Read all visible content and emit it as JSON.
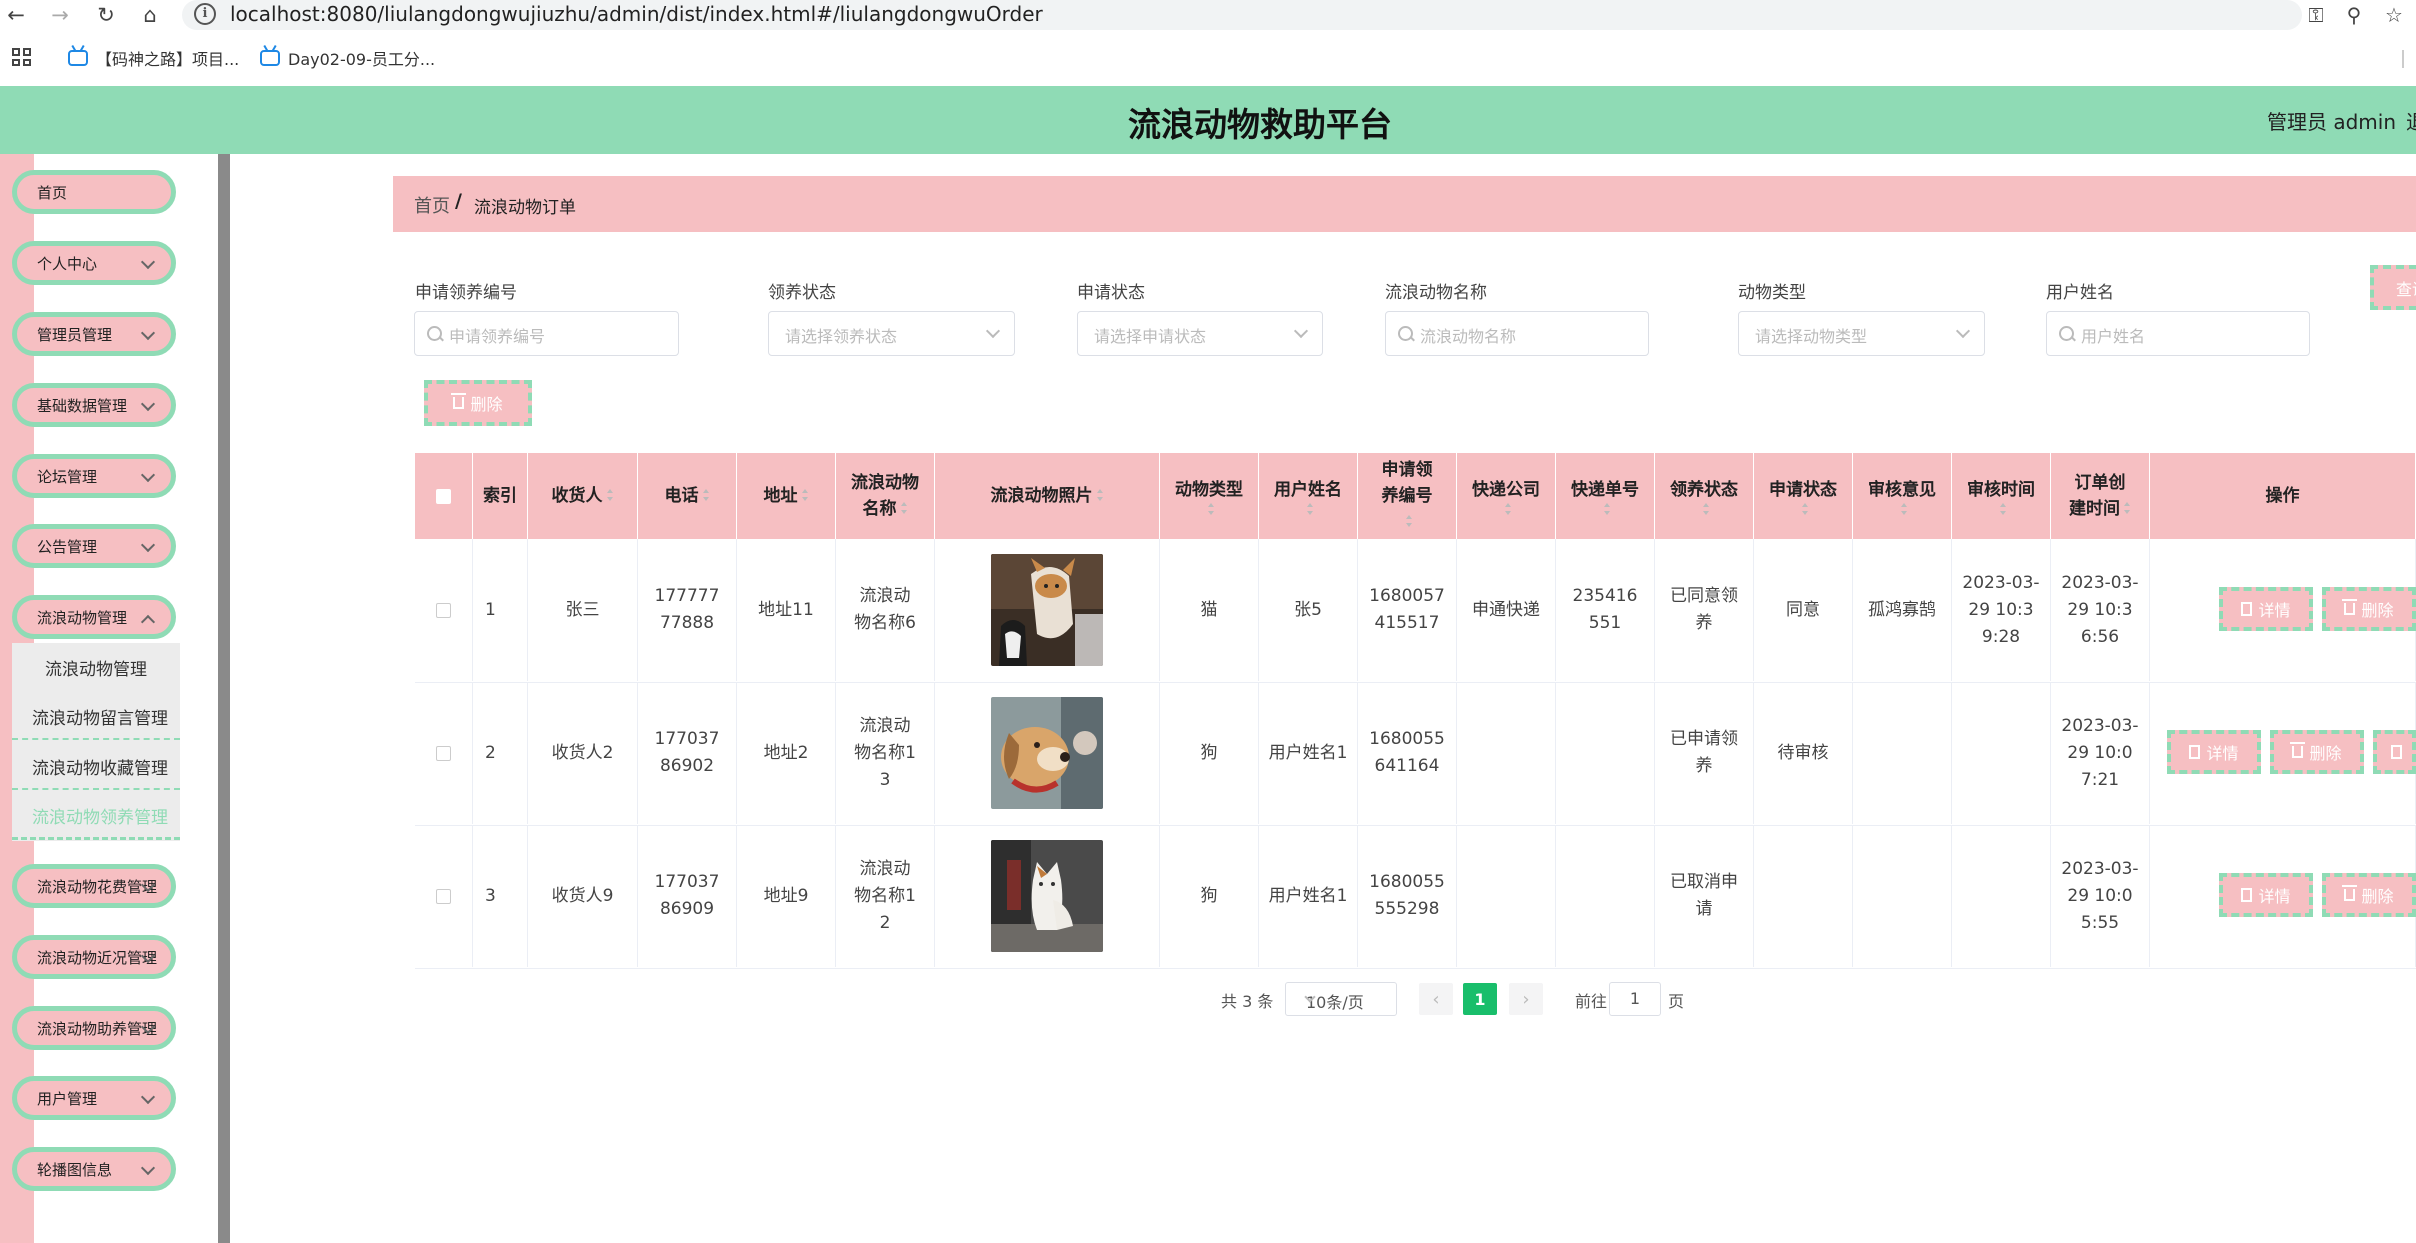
{
  "browser": {
    "url": "localhost:8080/liulangdongwujiuzhu/admin/dist/index.html#/liulangdongwuOrder",
    "bookmarks": [
      "【码神之路】项目...",
      "Day02-09-员工分..."
    ]
  },
  "header": {
    "title": "流浪动物救助平台",
    "admin": "管理员 admin",
    "exit": "退"
  },
  "sidebar": {
    "items": [
      {
        "label": "首页"
      },
      {
        "label": "个人中心"
      },
      {
        "label": "管理员管理"
      },
      {
        "label": "基础数据管理"
      },
      {
        "label": "论坛管理"
      },
      {
        "label": "公告管理"
      },
      {
        "label": "流浪动物管理"
      },
      {
        "label": "流浪动物花费管理"
      },
      {
        "label": "流浪动物近况管理"
      },
      {
        "label": "流浪动物助养管理"
      },
      {
        "label": "用户管理"
      },
      {
        "label": "轮播图信息"
      }
    ],
    "submenu": [
      {
        "label": "流浪动物管理"
      },
      {
        "label": "流浪动物留言管理"
      },
      {
        "label": "流浪动物收藏管理"
      },
      {
        "label": "流浪动物领养管理"
      }
    ]
  },
  "breadcrumb": {
    "home": "首页",
    "separator": "/",
    "current": "流浪动物订单"
  },
  "filters": [
    {
      "label": "申请领养编号",
      "placeholder": "申请领养编号"
    },
    {
      "label": "领养状态",
      "placeholder": "请选择领养状态"
    },
    {
      "label": "申请状态",
      "placeholder": "请选择申请状态"
    },
    {
      "label": "流浪动物名称",
      "placeholder": "流浪动物名称"
    },
    {
      "label": "动物类型",
      "placeholder": "请选择动物类型"
    },
    {
      "label": "用户姓名",
      "placeholder": "用户姓名"
    }
  ],
  "buttons": {
    "query": "查询",
    "delete": "删除",
    "detail": "详情",
    "remove": "删除"
  },
  "table": {
    "headers": [
      "索引",
      "收货人",
      "电话",
      "地址",
      "流浪动物名称",
      "流浪动物照片",
      "动物类型",
      "用户姓名",
      "申请领养编号",
      "快递公司",
      "快递单号",
      "领养状态",
      "申请状态",
      "审核意见",
      "审核时间",
      "订单创建时间",
      "操作"
    ],
    "rows": [
      {
        "index": "1",
        "consignee": "张三",
        "phone": "17777777888",
        "address": "地址11",
        "pet_name": "流浪动物名称6",
        "photo": "cat-and-dog-photo",
        "type": "猫",
        "user": "张5",
        "apply_no": "1680057415517",
        "courier": "申通快递",
        "tracking": "235416551",
        "adopt_status": "已同意领养",
        "apply_status": "同意",
        "review": "孤鸿寡鹄",
        "review_time": "2023-03-29 10:39:28",
        "created": "2023-03-29 10:36:56"
      },
      {
        "index": "2",
        "consignee": "收货人2",
        "phone": "17703786902",
        "address": "地址2",
        "pet_name": "流浪动物名称13",
        "photo": "puppy-photo",
        "type": "狗",
        "user": "用户姓名1",
        "apply_no": "1680055641164",
        "courier": "",
        "tracking": "",
        "adopt_status": "已申请领养",
        "apply_status": "待审核",
        "review": "",
        "review_time": "",
        "created": "2023-03-29 10:07:21"
      },
      {
        "index": "3",
        "consignee": "收货人9",
        "phone": "17703786909",
        "address": "地址9",
        "pet_name": "流浪动物名称12",
        "photo": "white-cat-photo",
        "type": "狗",
        "user": "用户姓名1",
        "apply_no": "1680055555298",
        "courier": "",
        "tracking": "",
        "adopt_status": "已取消申请",
        "apply_status": "",
        "review": "",
        "review_time": "",
        "created": "2023-03-29 10:05:55"
      }
    ]
  },
  "pagination": {
    "total": "共 3 条",
    "page_size": "10条/页",
    "current": "1",
    "goto": "前往",
    "goto_value": "1",
    "page_unit": "页"
  },
  "colors": {
    "header_green": "#8fdbb5",
    "pink": "#f6bfc2",
    "page_active": "#19be6b"
  }
}
